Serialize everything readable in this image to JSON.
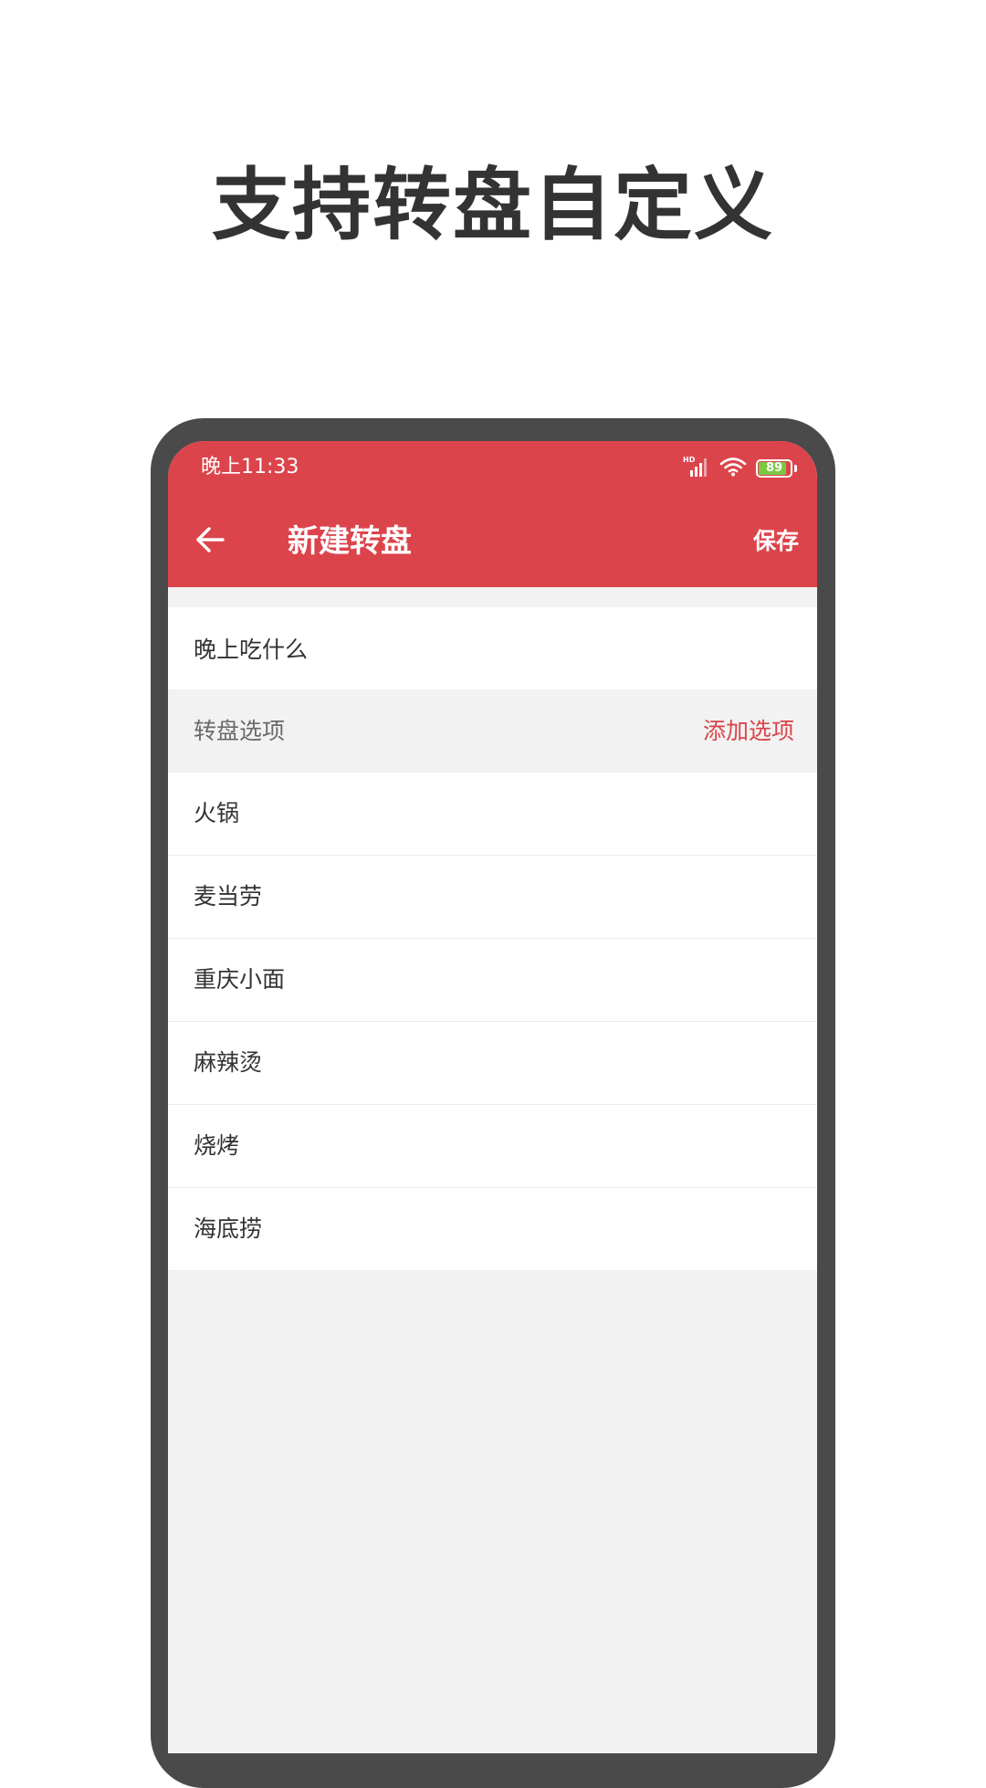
{
  "headline": "支持转盘自定义",
  "status_bar": {
    "time": "晚上11:33",
    "signal_icon": "signal-hd-icon",
    "wifi_icon": "wifi-icon",
    "battery_level": "89",
    "battery_fraction": 0.89,
    "battery_color": "#7ac943"
  },
  "toolbar": {
    "back_icon": "arrow-left-icon",
    "title": "新建转盘",
    "save_label": "保存",
    "color": "#dc444c"
  },
  "wheel_name": {
    "value": "晚上吃什么"
  },
  "options_section": {
    "label": "转盘选项",
    "add_label": "添加选项"
  },
  "options": [
    {
      "label": "火锅"
    },
    {
      "label": "麦当劳"
    },
    {
      "label": "重庆小面"
    },
    {
      "label": "麻辣烫"
    },
    {
      "label": "烧烤"
    },
    {
      "label": "海底捞"
    }
  ]
}
